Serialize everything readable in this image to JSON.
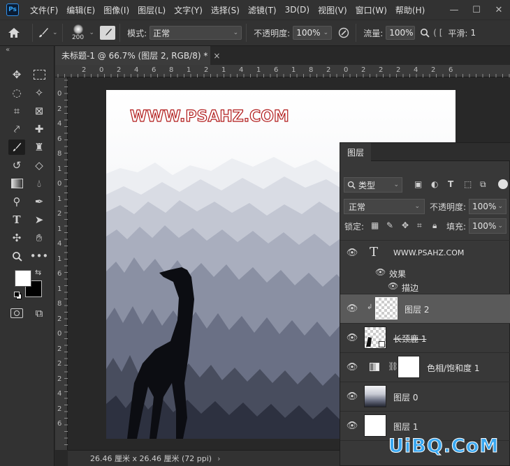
{
  "app": {
    "logo": "Ps"
  },
  "menu": [
    "文件(F)",
    "编辑(E)",
    "图像(I)",
    "图层(L)",
    "文字(Y)",
    "选择(S)",
    "滤镜(T)",
    "3D(D)",
    "视图(V)",
    "窗口(W)",
    "帮助(H)"
  ],
  "window_controls": {
    "minimize": "—",
    "restore": "☐",
    "close": "✕"
  },
  "options": {
    "brush_size": "200",
    "mode_label": "模式:",
    "mode_value": "正常",
    "opacity_label": "不透明度:",
    "opacity_value": "100%",
    "flow_label": "流量:",
    "flow_value": "100%",
    "smooth_label": "平滑:",
    "smooth_value": "1"
  },
  "document": {
    "tab_title": "未标题-1 @ 66.7% (图层 2, RGB/8) *",
    "close": "×",
    "status": "26.46 厘米 x 26.46 厘米 (72 ppi)",
    "status_arrow": "›"
  },
  "ruler": {
    "top_ticks": [
      "2",
      "0",
      "2",
      "4",
      "6",
      "8",
      "1",
      "2",
      "1",
      "4",
      "1",
      "6",
      "1",
      "8",
      "2",
      "0",
      "2",
      "2",
      "2",
      "4",
      "2",
      "6"
    ],
    "left_ticks": [
      "0",
      "2",
      "4",
      "6",
      "8",
      "1",
      "0",
      "1",
      "2",
      "1",
      "4",
      "1",
      "6",
      "1",
      "8",
      "2",
      "0",
      "2",
      "2",
      "2",
      "4",
      "2",
      "6"
    ]
  },
  "artwork": {
    "watermark_text": "WWW.PSAHZ.COM"
  },
  "layers_panel": {
    "tab": "图层",
    "filter_kind": "类型",
    "blend_mode": "正常",
    "opacity_label": "不透明度:",
    "opacity_value": "100%",
    "lock_label": "锁定:",
    "fill_label": "填充:",
    "fill_value": "100%",
    "layers": [
      {
        "name": "WWW.PSAHZ.COM",
        "kind": "text"
      },
      {
        "name": "效果",
        "kind": "effects"
      },
      {
        "name": "描边",
        "kind": "effect-item"
      },
      {
        "name": "图层 2",
        "kind": "pixel",
        "selected": true
      },
      {
        "name": "长颈鹿 1",
        "kind": "smart"
      },
      {
        "name": "色相/饱和度 1",
        "kind": "adjustment"
      },
      {
        "name": "图层 0",
        "kind": "pixel"
      },
      {
        "name": "图层 1",
        "kind": "pixel"
      }
    ]
  },
  "site_watermark": "UiBQ.CoM",
  "colors": {
    "accent": "#31a8ff",
    "panel": "#323232",
    "canvas": "#282828",
    "watermark_stroke": "#b11a1a"
  }
}
